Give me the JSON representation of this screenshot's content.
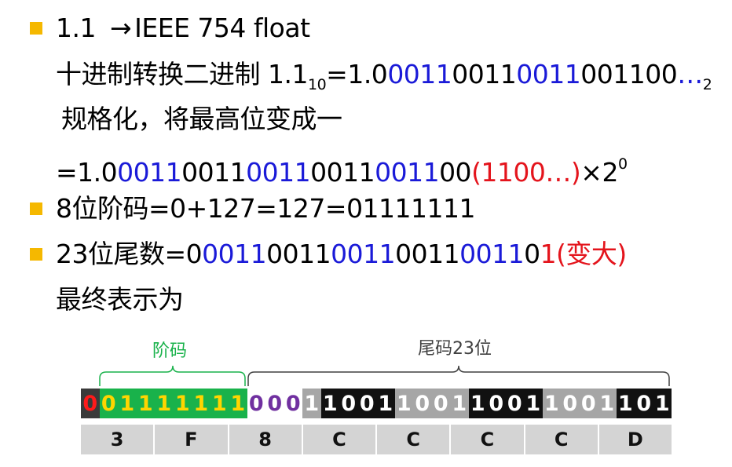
{
  "lines": {
    "l1": {
      "num": "1.1",
      "arrow": "→",
      "rest": "IEEE 754 float"
    },
    "l2": {
      "prefix": "十进制转换二进制 1.1",
      "sub": "10",
      "eq": "=1.0",
      "a": "0011",
      "b": "0011",
      "c": "0011",
      "d": "001100",
      "e": "…",
      "base": "2"
    },
    "l3": {
      "text": "规格化，将最高位变成一"
    },
    "l4": {
      "eq": "=1.0",
      "a": "0011",
      "b": "0011",
      "c": "0011",
      "d": "0011",
      "e": "0011",
      "f": "00",
      "red": "(1100…)",
      "times": "×2",
      "exp": "0"
    },
    "l5": {
      "text": "8位阶码=0+127=127=01111111"
    },
    "l6": {
      "pre": "23位尾数=0",
      "a": "0011",
      "b": "0011",
      "c": "0011",
      "d": "0011",
      "e": "0011",
      "f": "0",
      "red": "1(变大)"
    },
    "l7": {
      "text": "最终表示为"
    }
  },
  "diagram": {
    "exp_label": "阶码",
    "mant_label": "尾码23位",
    "sign_bit": "0",
    "exp_bits": [
      "0",
      "1",
      "1",
      "1",
      "1",
      "1",
      "1",
      "1"
    ],
    "implicit_bits": [
      "0",
      "0",
      "0"
    ],
    "mant_bits": [
      "1",
      "1",
      "0",
      "0",
      "1",
      "1",
      "0",
      "0",
      "1",
      "1",
      "0",
      "0",
      "1",
      "1",
      "0",
      "0",
      "1",
      "1",
      "0",
      "1"
    ],
    "hex": [
      "3",
      "F",
      "8",
      "C",
      "C",
      "C",
      "C",
      "D"
    ]
  },
  "colors": {
    "bullet": "#f5b800",
    "blue": "#1a1ad8",
    "red": "#e4141c",
    "exp_bg": "#19b24b",
    "exp_fg": "#ffd500",
    "implicit_fg": "#7030a0",
    "sign_fg": "#ff1a1a",
    "dark_cell": "#111111",
    "light_cell": "#a6a6a6",
    "hex_bg": "#d4d4d4",
    "brace_green": "#19b24b"
  }
}
